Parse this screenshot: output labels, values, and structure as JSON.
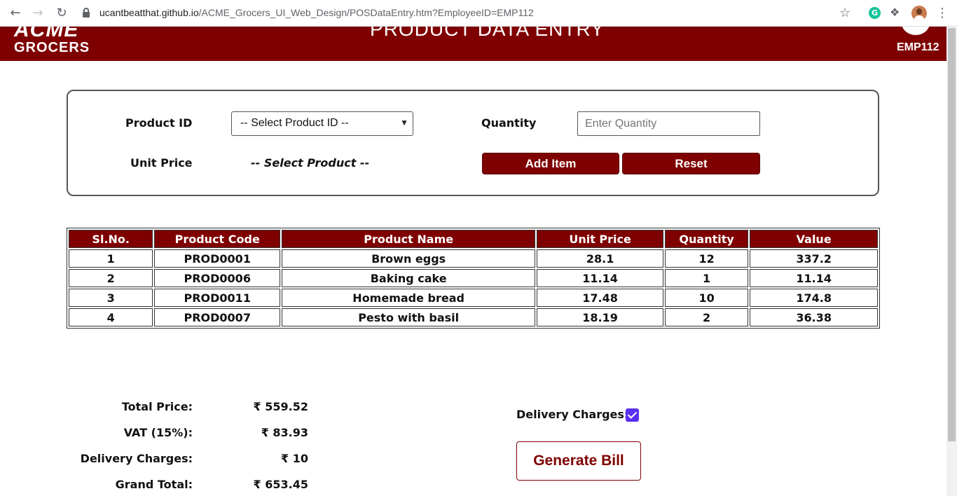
{
  "browser": {
    "url_host": "ucantbeatthat.github.io",
    "url_path": "/ACME_Grocers_UI_Web_Design/POSDataEntry.htm?EmployeeID=EMP112",
    "extension_g": "G"
  },
  "header": {
    "logo_line1": "ACME",
    "logo_line2": "GROCERS",
    "title": "PRODUCT DATA ENTRY",
    "employee_id": "EMP112",
    "background_color": "#7f0000"
  },
  "form": {
    "product_id_label": "Product ID",
    "product_id_selected": "-- Select Product ID --",
    "quantity_label": "Quantity",
    "quantity_placeholder": "Enter Quantity",
    "unit_price_label": "Unit Price",
    "unit_price_value": "-- Select Product --",
    "add_item_label": "Add Item",
    "reset_label": "Reset"
  },
  "table": {
    "headers": [
      "Sl.No.",
      "Product Code",
      "Product Name",
      "Unit Price",
      "Quantity",
      "Value"
    ],
    "rows": [
      [
        "1",
        "PROD0001",
        "Brown eggs",
        "28.1",
        "12",
        "337.2"
      ],
      [
        "2",
        "PROD0006",
        "Baking cake",
        "11.14",
        "1",
        "11.14"
      ],
      [
        "3",
        "PROD0011",
        "Homemade bread",
        "17.48",
        "10",
        "174.8"
      ],
      [
        "4",
        "PROD0007",
        "Pesto with basil",
        "18.19",
        "2",
        "36.38"
      ]
    ]
  },
  "totals": {
    "total_price_label": "Total Price:",
    "total_price_value": "₹ 559.52",
    "vat_label": "VAT (15%):",
    "vat_value": "₹ 83.93",
    "delivery_label": "Delivery Charges:",
    "delivery_value": "₹ 10",
    "grand_total_label": "Grand Total:",
    "grand_total_value": "₹ 653.45"
  },
  "delivery": {
    "label": "Delivery Charges:",
    "checked": true
  },
  "generate_bill_label": "Generate Bill"
}
